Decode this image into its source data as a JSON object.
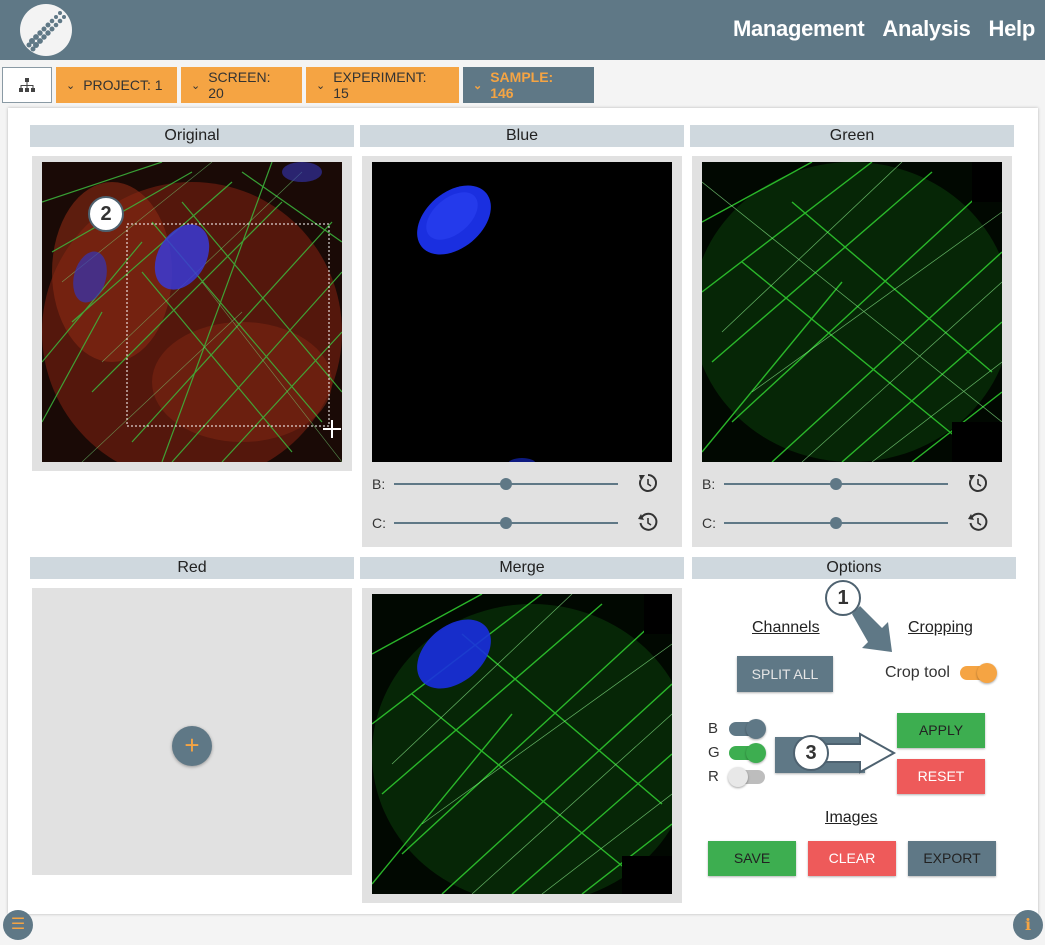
{
  "nav": {
    "items": [
      "Management",
      "Analysis",
      "Help"
    ]
  },
  "breadcrumb": {
    "project": "PROJECT: 1",
    "screen": "SCREEN: 20",
    "experiment": "EXPERIMENT: 15",
    "sample": "SAMPLE: 146"
  },
  "panels": {
    "original": "Original",
    "blue": "Blue",
    "green": "Green",
    "red": "Red",
    "merge": "Merge",
    "options": "Options"
  },
  "sliders": {
    "brightness_label": "B:",
    "contrast_label": "C:",
    "blue": {
      "brightness": 0.5,
      "contrast": 0.5
    },
    "green": {
      "brightness": 0.5,
      "contrast": 0.5
    }
  },
  "options": {
    "channels_title": "Channels",
    "cropping_title": "Cropping",
    "split_all": "SPLIT ALL",
    "crop_tool_label": "Crop tool",
    "crop_tool_on": true,
    "channel_toggles": [
      {
        "label": "B",
        "on": true,
        "color": "#5f7886"
      },
      {
        "label": "G",
        "on": true,
        "color": "#3dae50"
      },
      {
        "label": "R",
        "on": false,
        "color": "#bdbdbd"
      }
    ],
    "apply": "APPLY",
    "reset": "RESET",
    "images_title": "Images",
    "save": "SAVE",
    "clear": "CLEAR",
    "export": "EXPORT"
  },
  "callouts": [
    "1",
    "2",
    "3"
  ],
  "colors": {
    "accent": "#f5a443",
    "slate": "#5f7886",
    "success": "#3dae50",
    "danger": "#ee5a5a",
    "header": "#cfd8de"
  },
  "icons": [
    "sitemap-icon",
    "chevron-down-icon",
    "restore-icon",
    "history-icon",
    "plus-icon",
    "menu-icon",
    "info-icon"
  ]
}
